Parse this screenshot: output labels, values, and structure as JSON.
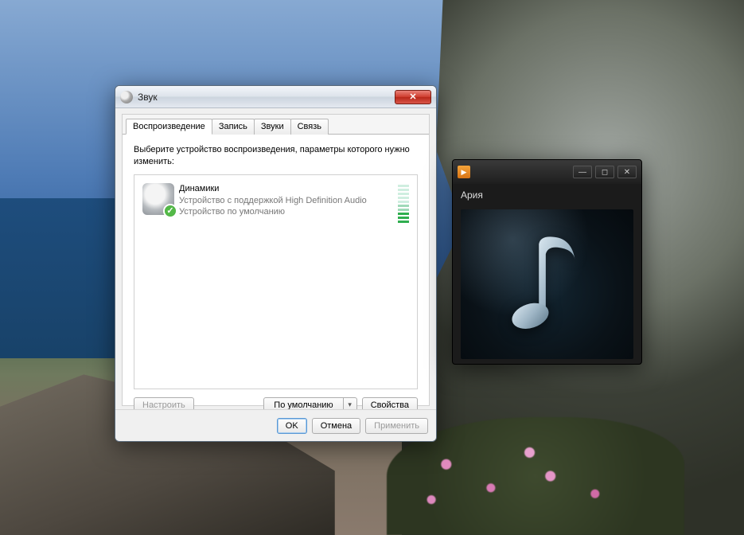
{
  "sound_dialog": {
    "title": "Звук",
    "close_glyph": "✕",
    "tabs": {
      "playback": "Воспроизведение",
      "recording": "Запись",
      "sounds": "Звуки",
      "communications": "Связь"
    },
    "instruction": "Выберите устройство воспроизведения, параметры которого нужно изменить:",
    "device": {
      "name": "Динамики",
      "desc": "Устройство с поддержкой High Definition Audio",
      "status": "Устройство по умолчанию",
      "check_glyph": "✓"
    },
    "buttons": {
      "configure": "Настроить",
      "set_default": "По умолчанию",
      "dropdown_glyph": "▾",
      "properties": "Свойства"
    },
    "footer": {
      "ok": "OK",
      "cancel": "Отмена",
      "apply": "Применить"
    }
  },
  "media_player": {
    "play_glyph": "▶",
    "track_title": "Ария",
    "min_glyph": "—",
    "max_glyph": "◻",
    "close_glyph": "✕"
  }
}
